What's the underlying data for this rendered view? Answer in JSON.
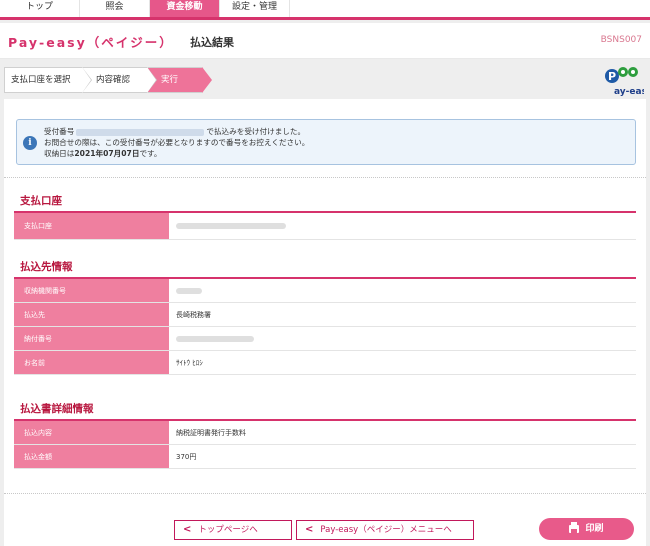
{
  "nav": {
    "tabs": [
      "トップ",
      "照会",
      "資金移動",
      "設定・管理"
    ],
    "active_index": 2
  },
  "header": {
    "brand": "Pay-easy（ペイジー）",
    "title": "払込結果",
    "screen_code": "BSNS007"
  },
  "steps": [
    "支払口座を選択",
    "内容確認",
    "実行"
  ],
  "logo": {
    "text": "ay-easy",
    "letter": "P"
  },
  "notice": {
    "line1_prefix": "受付番号",
    "line1_suffix": "で払込みを受け付けました。",
    "line2": "お問合せの際は、この受付番号が必要となりますので番号をお控えください。",
    "line3_prefix": "収納日は",
    "line3_date": "2021年07月07日",
    "line3_suffix": "です。"
  },
  "sections": {
    "account": {
      "title": "支払口座",
      "rows": [
        {
          "label": "支払口座"
        }
      ]
    },
    "payee": {
      "title": "払込先情報",
      "rows": [
        {
          "label": "収納機関番号",
          "value": ""
        },
        {
          "label": "払込先",
          "value": "長崎税務署"
        },
        {
          "label": "納付番号",
          "value": ""
        },
        {
          "label": "お名前",
          "value": "ｻｲﾄｳ ﾋﾛｼ"
        }
      ]
    },
    "details": {
      "title": "払込書詳細情報",
      "rows": [
        {
          "label": "払込内容",
          "value": "納税証明書発行手数料"
        },
        {
          "label": "払込金額",
          "value": "370円"
        }
      ]
    }
  },
  "buttons": {
    "top": "トップページへ",
    "menu": "Pay-easy（ペイジー）メニューへ",
    "print": "印刷"
  },
  "colors": {
    "accent": "#d6336c",
    "label_bg": "#ef7f9f",
    "info_bg": "#edf4fb"
  }
}
